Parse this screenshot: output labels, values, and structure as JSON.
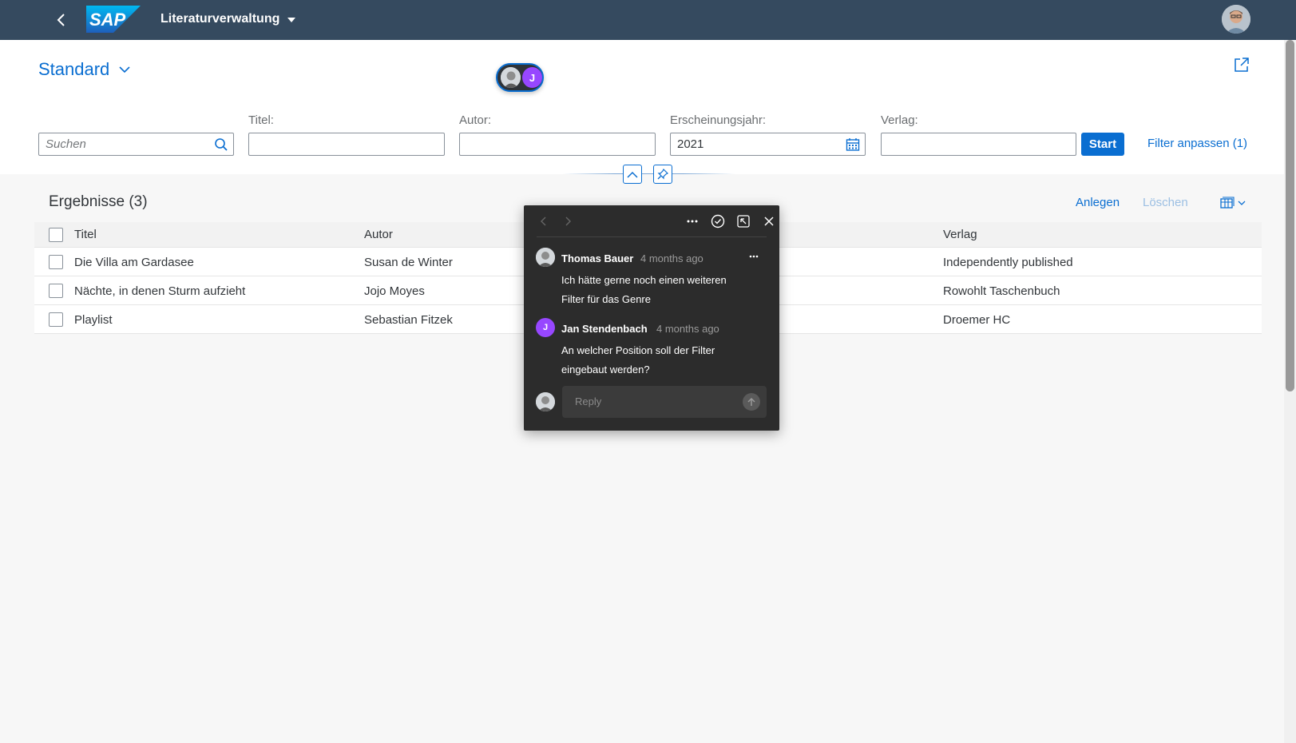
{
  "shell": {
    "app_title": "Literaturverwaltung",
    "logo_text": "SAP"
  },
  "header": {
    "variant": "Standard",
    "collaborator_initial": "J"
  },
  "filters": {
    "search_placeholder": "Suchen",
    "title_label": "Titel:",
    "author_label": "Autor:",
    "year_label": "Erscheinungsjahr:",
    "year_value": "2021",
    "publisher_label": "Verlag:",
    "start_label": "Start",
    "adapt_label": "Filter anpassen (1)"
  },
  "results": {
    "title": "Ergebnisse (3)",
    "create_label": "Anlegen",
    "delete_label": "Löschen",
    "columns": [
      "Titel",
      "Autor",
      "Verlag"
    ],
    "rows": [
      {
        "title": "Die Villa am Gardasee",
        "author": "Susan de Winter",
        "publisher": "Independently published"
      },
      {
        "title": "Nächte, in denen Sturm aufzieht",
        "author": "Jojo Moyes",
        "publisher": "Rowohlt Taschenbuch"
      },
      {
        "title": "Playlist",
        "author": "Sebastian Fitzek",
        "publisher": "Droemer HC"
      }
    ]
  },
  "comments": {
    "thread": [
      {
        "author": "Thomas Bauer",
        "time": "4 months ago",
        "text_line1": "Ich hätte gerne noch einen weiteren",
        "text_line2": "Filter für das Genre"
      },
      {
        "author": "Jan Stendenbach",
        "initial": "J",
        "time": "4 months ago",
        "text_line1": "An welcher Position soll der Filter",
        "text_line2": "eingebaut werden?"
      }
    ],
    "reply_placeholder": "Reply"
  },
  "colors": {
    "shell": "#354a5f",
    "accent": "#0a6ed1",
    "collaborator": "#9747ff",
    "popover": "#2c2c2c"
  }
}
